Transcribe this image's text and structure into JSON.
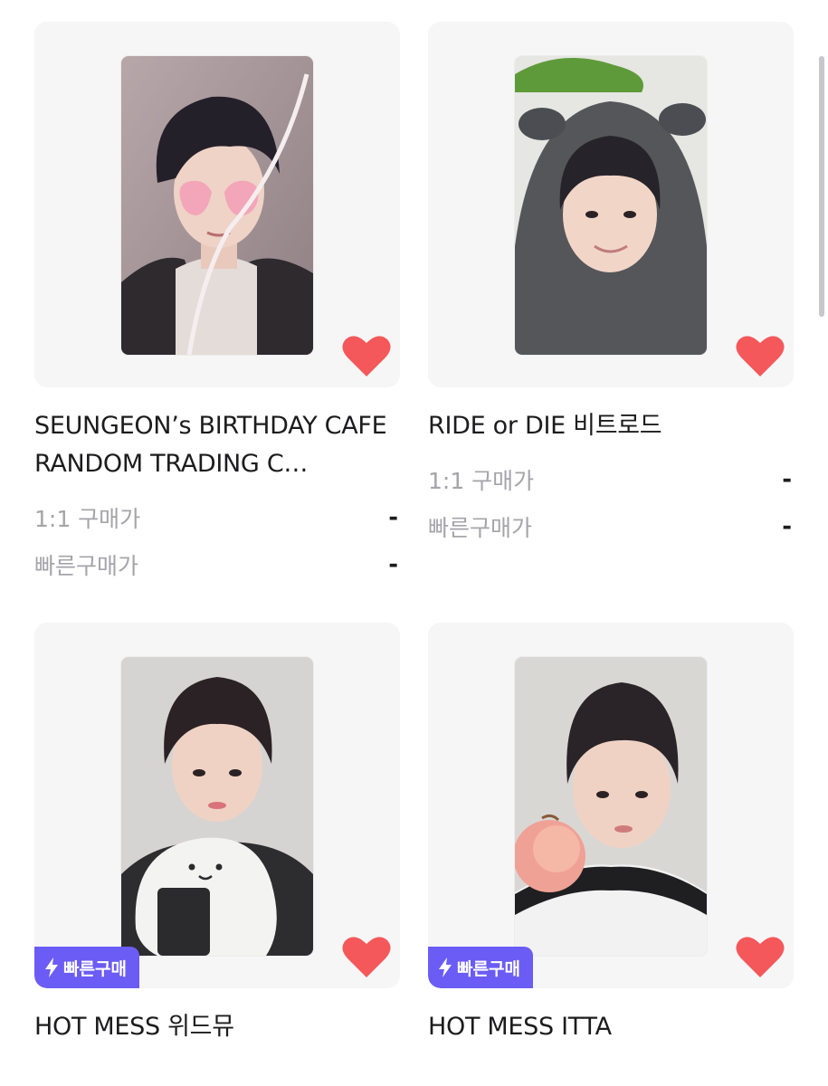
{
  "colors": {
    "card_bg": "#f6f6f7",
    "heart": "#f4585a",
    "badge": "#6b5cf6",
    "label_gray": "#a4a4aa",
    "text": "#1c1c1e"
  },
  "products": [
    {
      "title": "SEUNGEON’s BIRTHDAY CAFE RANDOM TRADING C…",
      "liked": true,
      "quick_buy_badge": null,
      "price_rows": [
        {
          "label": "1:1 구매가",
          "value": "-"
        },
        {
          "label": "빠른구매가",
          "value": "-"
        }
      ]
    },
    {
      "title": "RIDE or DIE 비트로드",
      "liked": true,
      "quick_buy_badge": null,
      "price_rows": [
        {
          "label": "1:1 구매가",
          "value": "-"
        },
        {
          "label": "빠른구매가",
          "value": "-"
        }
      ]
    },
    {
      "title": "HOT MESS 위드뮤",
      "liked": true,
      "quick_buy_badge": "빠른구매",
      "price_rows": []
    },
    {
      "title": "HOT MESS ITTA",
      "liked": true,
      "quick_buy_badge": "빠른구매",
      "price_rows": []
    }
  ],
  "icons": {
    "like": "heart-icon",
    "quick_buy": "lightning-bolt-icon"
  }
}
